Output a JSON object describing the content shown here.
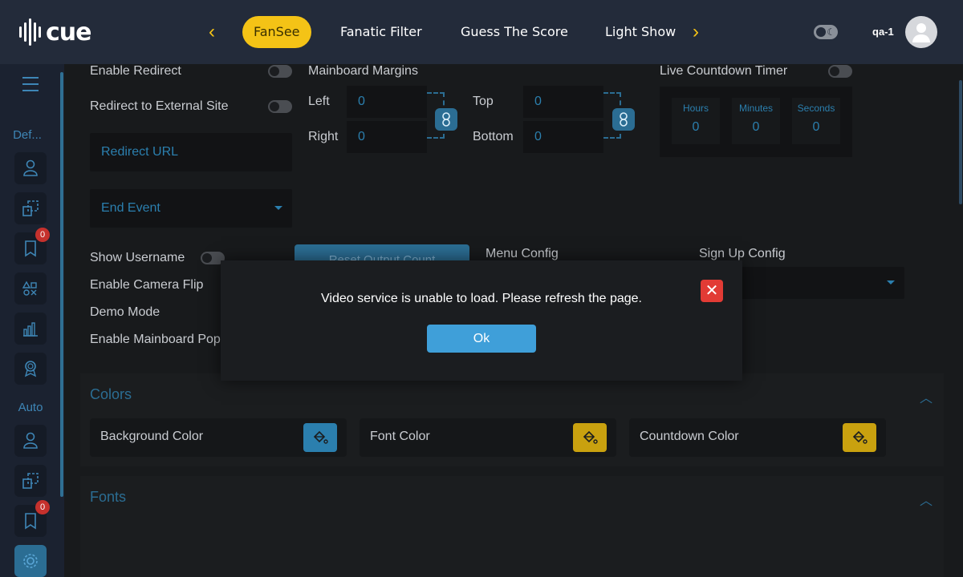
{
  "header": {
    "logo_text": "cue",
    "tabs": [
      {
        "label": "FanSee",
        "active": true
      },
      {
        "label": "Fanatic Filter"
      },
      {
        "label": "Guess The Score"
      },
      {
        "label": "Light Show"
      }
    ],
    "username": "qa-1"
  },
  "sidebar": {
    "sections": [
      {
        "label": "Def...",
        "items": [
          "user-icon",
          "copy-icon",
          "ribbon-icon",
          "shapes-icon",
          "bar-chart-icon",
          "award-icon"
        ],
        "ribbon_badge": "0"
      },
      {
        "label": "Auto",
        "items": [
          "user-icon",
          "copy-icon",
          "ribbon-icon",
          "settings-icon"
        ],
        "ribbon_badge": "0"
      }
    ]
  },
  "form": {
    "enable_redirect": "Enable Redirect",
    "redirect_external": "Redirect to External Site",
    "redirect_url_placeholder": "Redirect URL",
    "end_event_placeholder": "End Event",
    "mainboard_margins": "Mainboard Margins",
    "left_label": "Left",
    "right_label": "Right",
    "top_label": "Top",
    "bottom_label": "Bottom",
    "left_value": "0",
    "right_value": "0",
    "top_value": "0",
    "bottom_value": "0",
    "live_countdown": "Live Countdown Timer",
    "hours_label": "Hours",
    "minutes_label": "Minutes",
    "seconds_label": "Seconds",
    "hours_value": "0",
    "minutes_value": "0",
    "seconds_value": "0",
    "show_username": "Show Username",
    "enable_camera_flip": "Enable Camera Flip",
    "demo_mode": "Demo Mode",
    "enable_mainboard_popup": "Enable Mainboard Pop",
    "reset_output_count": "Reset Output Count",
    "menu_config": "Menu Config",
    "sign_up_config": "Sign Up Config"
  },
  "colors_panel": {
    "title": "Colors",
    "cards": [
      {
        "label": "Background Color",
        "color": "#2b7fae"
      },
      {
        "label": "Font Color",
        "color": "#c9a10f"
      },
      {
        "label": "Countdown Color",
        "color": "#c9a10f"
      }
    ]
  },
  "fonts_panel": {
    "title": "Fonts"
  },
  "modal": {
    "message": "Video service is unable to load. Please refresh the page.",
    "ok_label": "Ok"
  }
}
